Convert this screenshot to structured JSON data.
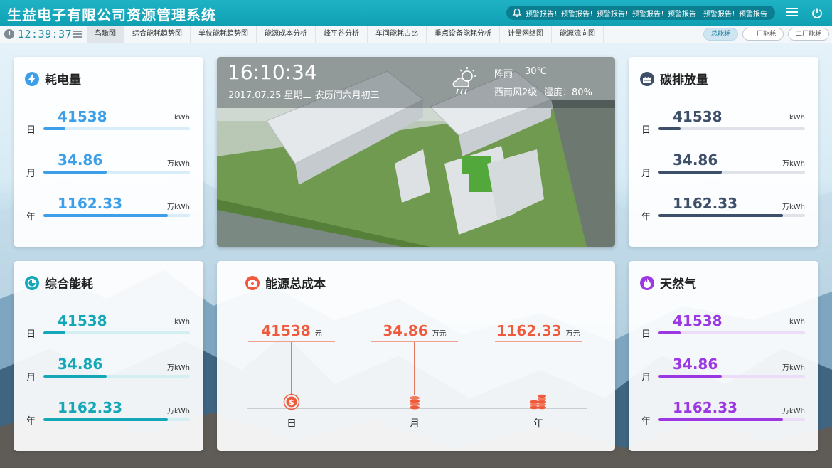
{
  "header": {
    "title": "生益电子有限公司资源管理系统",
    "alert_text": "预警报告！预警报告！预警报告！预警报告！预警报告！预警报告！预警报告！"
  },
  "nav": {
    "time": "12:39:37",
    "tabs": [
      "鸟瞰图",
      "综合能耗趋势图",
      "单位能耗趋势图",
      "能源成本分析",
      "峰平谷分析",
      "车间能耗占比",
      "重点设备能耗分析",
      "计量网络图",
      "能源流向图"
    ],
    "active_tab": "鸟瞰图",
    "factory_buttons": [
      "总能耗",
      "一厂能耗",
      "二厂能耗"
    ]
  },
  "colors": {
    "header": "#13a9bc",
    "electric": "#3d9fe8",
    "carbon": "#3e4f6a",
    "energy": "#14a7b8",
    "gas": "#9b38e3",
    "cost": "#f05a3c"
  },
  "cards": {
    "electricity": {
      "title": "耗电量",
      "icon": "lightning-icon",
      "rows": [
        {
          "label": "日",
          "value": "41538",
          "unit": "kWh",
          "level": 0.15
        },
        {
          "label": "月",
          "value": "34.86",
          "unit": "万kWh",
          "level": 0.43
        },
        {
          "label": "年",
          "value": "1162.33",
          "unit": "万kWh",
          "level": 0.85
        }
      ]
    },
    "carbon": {
      "title": "碳排放量",
      "icon": "factory-icon",
      "rows": [
        {
          "label": "日",
          "value": "41538",
          "unit": "kWh",
          "level": 0.15
        },
        {
          "label": "月",
          "value": "34.86",
          "unit": "万kWh",
          "level": 0.43
        },
        {
          "label": "年",
          "value": "1162.33",
          "unit": "万kWh",
          "level": 0.85
        }
      ]
    },
    "energy": {
      "title": "综合能耗",
      "icon": "pie-icon",
      "rows": [
        {
          "label": "日",
          "value": "41538",
          "unit": "kWh",
          "level": 0.15
        },
        {
          "label": "月",
          "value": "34.86",
          "unit": "万kWh",
          "level": 0.43
        },
        {
          "label": "年",
          "value": "1162.33",
          "unit": "万kWh",
          "level": 0.85
        }
      ]
    },
    "gas": {
      "title": "天然气",
      "icon": "flame-icon",
      "rows": [
        {
          "label": "日",
          "value": "41538",
          "unit": "kWh",
          "level": 0.15
        },
        {
          "label": "月",
          "value": "34.86",
          "unit": "万kWh",
          "level": 0.43
        },
        {
          "label": "年",
          "value": "1162.33",
          "unit": "万kWh",
          "level": 0.85
        }
      ]
    },
    "cost": {
      "title": "能源总成本",
      "icon": "money-icon",
      "cols": [
        {
          "value": "41538",
          "unit": "元",
          "label": "日",
          "icon": "dollar-coin-icon"
        },
        {
          "value": "34.86",
          "unit": "万元",
          "label": "月",
          "icon": "coin-stack-icon"
        },
        {
          "value": "1162.33",
          "unit": "万元",
          "label": "年",
          "icon": "coin-stacks-icon"
        }
      ]
    }
  },
  "photo": {
    "time": "16:10:34",
    "date": "2017.07.25 星期二 农历闰六月初三",
    "weather": "阵雨",
    "temp": "30℃",
    "wind": "西南风2级",
    "humidity": "湿度：80%",
    "weather_icon": "cloud-sun-rain-icon"
  }
}
